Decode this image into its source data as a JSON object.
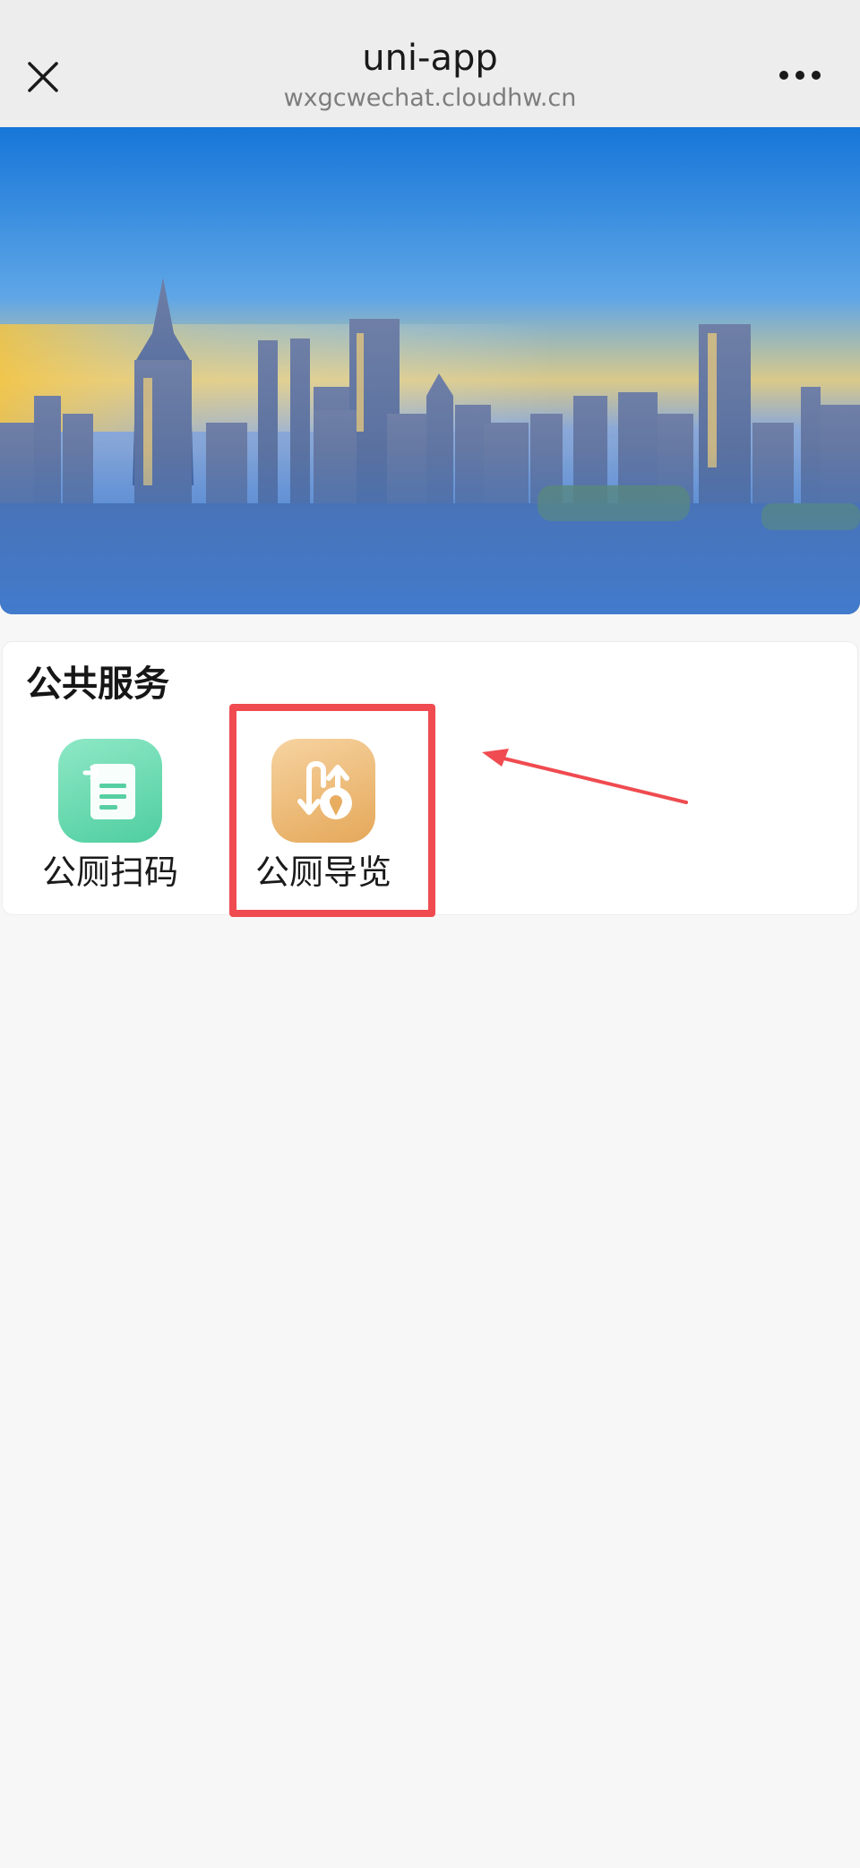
{
  "navbar": {
    "title": "uni-app",
    "subtitle": "wxgcwechat.cloudhw.cn",
    "close_icon": "close-icon",
    "more_icon": "more-dots-icon"
  },
  "banner": {
    "description_icon": "city-skyline-banner"
  },
  "services": {
    "title": "公共服务",
    "items": [
      {
        "label": "公厕扫码",
        "icon": "scan-document-icon",
        "color": "#5ed3a9"
      },
      {
        "label": "公厕导览",
        "icon": "route-location-icon",
        "color": "#eab46c"
      }
    ]
  },
  "annotation": {
    "highlight_color": "#ef4b50"
  }
}
